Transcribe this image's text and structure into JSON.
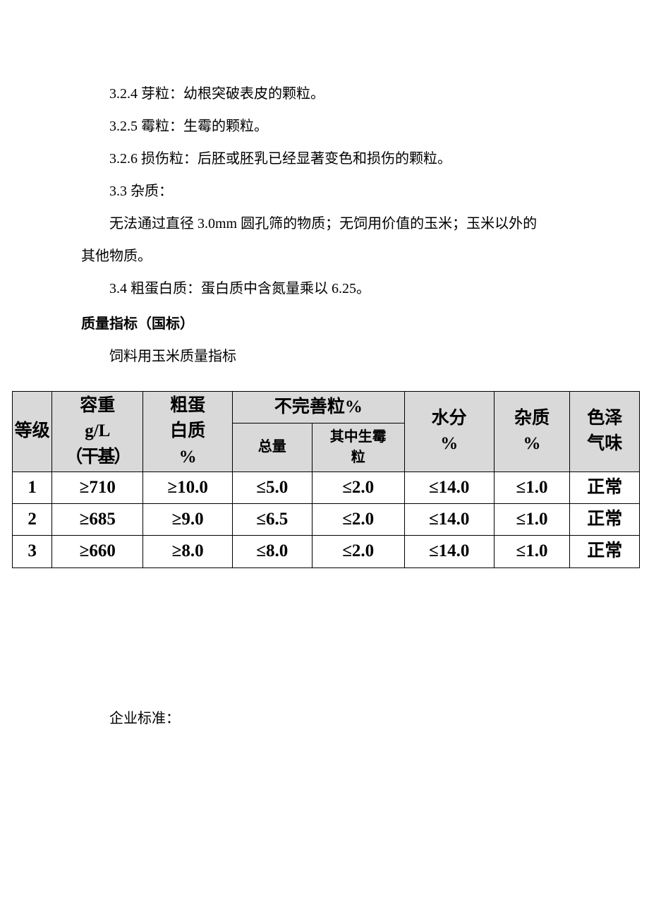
{
  "paragraphs": {
    "p1": "3.2.4 芽粒：幼根突破表皮的颗粒。",
    "p2": "3.2.5 霉粒：生霉的颗粒。",
    "p3": "3.2.6 损伤粒：后胚或胚乳已经显著变色和损伤的颗粒。",
    "p4": "3.3 杂质：",
    "p5": "无法通过直径 3.0mm 圆孔筛的物质；无饲用价值的玉米；玉米以外的",
    "p5b": "其他物质。",
    "p6": "3.4 粗蛋白质：蛋白质中含氮量乘以 6.25。",
    "h1": "质量指标（国标）",
    "p7": "饲料用玉米质量指标",
    "p8": "企业标准："
  },
  "table": {
    "headers": {
      "col1": "等级",
      "col2_l1": "容重",
      "col2_l2": "g/L",
      "col2_l3": "（干基）",
      "col3_l1": "粗蛋",
      "col3_l2": "白质",
      "col3_l3": "%",
      "col4": "不完善粒%",
      "col4a": "总量",
      "col4b_l1": "其中生霉",
      "col4b_l2": "粒",
      "col5_l1": "水分",
      "col5_l2": "%",
      "col6_l1": "杂质",
      "col6_l2": "%",
      "col7_l1": "色泽",
      "col7_l2": "气味"
    },
    "rows": [
      {
        "grade": "1",
        "bulk": "≥710",
        "protein": "≥10.0",
        "imp_total": "≤5.0",
        "imp_mold": "≤2.0",
        "moisture": "≤14.0",
        "impurity": "≤1.0",
        "color": "正常"
      },
      {
        "grade": "2",
        "bulk": "≥685",
        "protein": "≥9.0",
        "imp_total": "≤6.5",
        "imp_mold": "≤2.0",
        "moisture": "≤14.0",
        "impurity": "≤1.0",
        "color": "正常"
      },
      {
        "grade": "3",
        "bulk": "≥660",
        "protein": "≥8.0",
        "imp_total": "≤8.0",
        "imp_mold": "≤2.0",
        "moisture": "≤14.0",
        "impurity": "≤1.0",
        "color": "正常"
      }
    ]
  }
}
